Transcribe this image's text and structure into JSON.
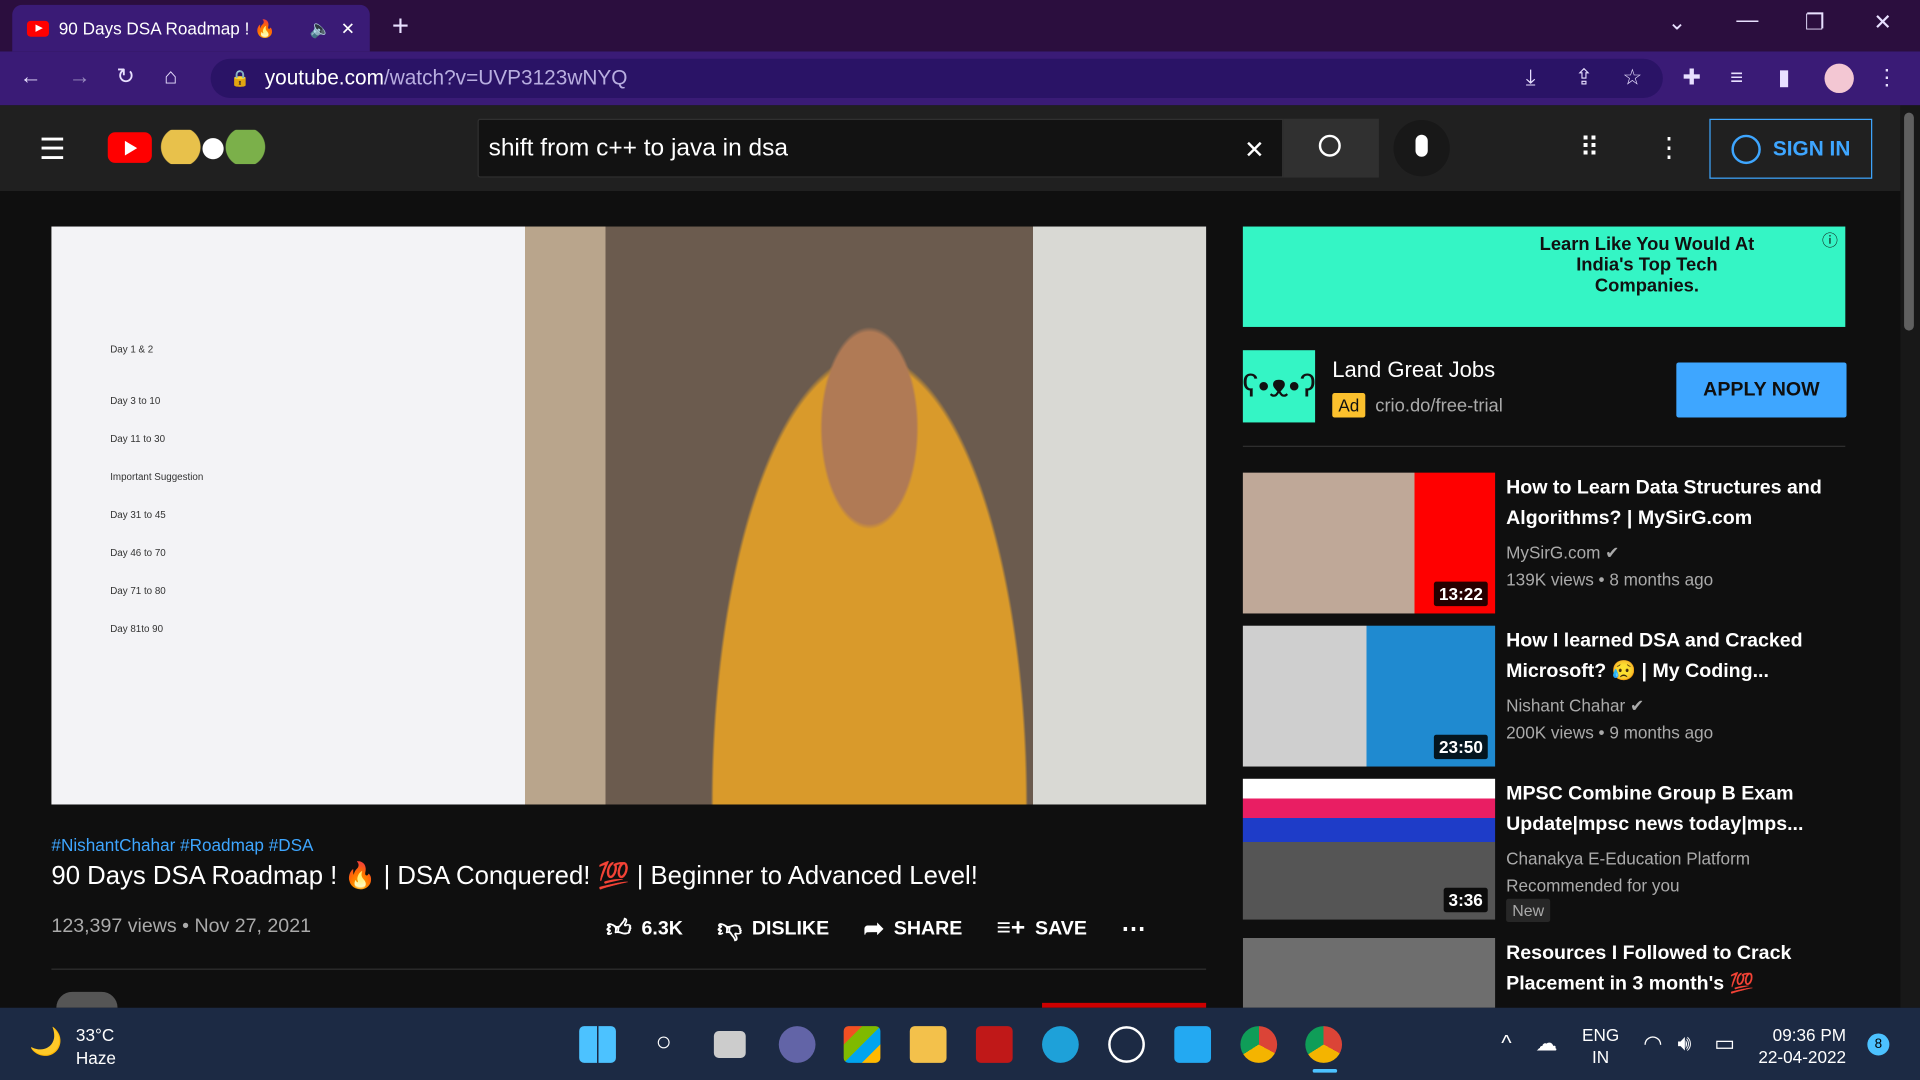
{
  "browser": {
    "tab_title": "90 Days DSA Roadmap ! 🔥",
    "url_host": "youtube.com",
    "url_path": "/watch?v=UVP3123wNYQ"
  },
  "header": {
    "search_value": "shift from c++ to java in dsa",
    "sign_in": "SIGN IN"
  },
  "video": {
    "tags": "#NishantChahar #Roadmap #DSA",
    "title": "90 Days DSA Roadmap ! 🔥 | DSA Conquered! 💯 | Beginner to Advanced Level!",
    "views": "123,397 views",
    "date": "Nov 27, 2021",
    "likes": "6.3K",
    "dislike": "DISLIKE",
    "share": "SHARE",
    "save": "SAVE",
    "whiteboard": [
      "Day 1 & 2",
      "Day 3 to 10",
      "Day 11 to 30",
      "Important Suggestion",
      "Day 31 to 45",
      "Day 46 to 70",
      "Day 71 to 80",
      "Day 81to 90"
    ]
  },
  "ad": {
    "banner": "Learn Like You Would At India's Top Tech Companies.",
    "title": "Land Great Jobs",
    "badge": "Ad",
    "domain": "crio.do/free-trial",
    "cta": "APPLY NOW"
  },
  "recommendations": [
    {
      "title": "How to Learn Data Structures and Algorithms? | MySirG.com",
      "channel": "MySirG.com",
      "stats": "139K views • 8 months ago",
      "duration": "13:22",
      "verified": true
    },
    {
      "title": "How I learned DSA and Cracked Microsoft? 😥 | My Coding...",
      "channel": "Nishant Chahar",
      "stats": "200K views • 9 months ago",
      "duration": "23:50",
      "verified": true
    },
    {
      "title": "MPSC Combine Group B Exam Update|mpsc news today|mps...",
      "channel": "Chanakya E-Education Platform",
      "stats": "Recommended for you",
      "duration": "3:36",
      "badge": "New"
    },
    {
      "title": "Resources I Followed to Crack Placement in 3 month's 💯",
      "channel": "",
      "stats": "",
      "duration": ""
    }
  ],
  "taskbar": {
    "temp": "33°C",
    "weather": "Haze",
    "lang1": "ENG",
    "lang2": "IN",
    "time": "09:36 PM",
    "date": "22-04-2022",
    "notif": "8"
  }
}
